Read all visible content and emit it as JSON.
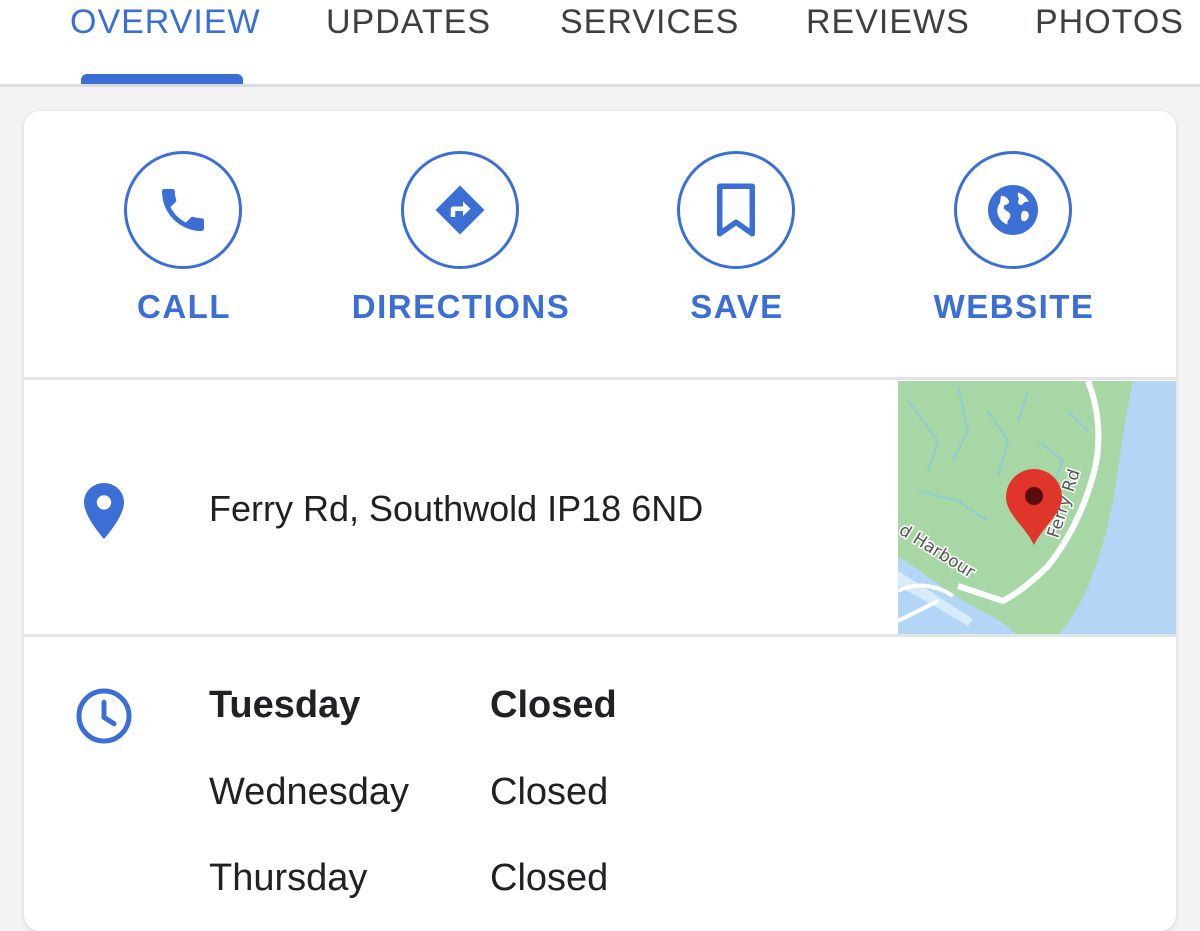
{
  "tabs": [
    {
      "label": "OVERVIEW",
      "active": true
    },
    {
      "label": "UPDATES",
      "active": false
    },
    {
      "label": "SERVICES",
      "active": false
    },
    {
      "label": "REVIEWS",
      "active": false
    },
    {
      "label": "PHOTOS",
      "active": false
    }
  ],
  "actions": [
    {
      "label": "CALL",
      "icon": "phone-icon"
    },
    {
      "label": "DIRECTIONS",
      "icon": "directions-icon"
    },
    {
      "label": "SAVE",
      "icon": "bookmark-icon"
    },
    {
      "label": "WEBSITE",
      "icon": "globe-icon"
    }
  ],
  "address": {
    "text": "Ferry Rd, Southwold IP18 6ND",
    "icon": "location-pin-icon"
  },
  "map": {
    "road_label": "Ferry Rd",
    "harbour_label": "d Harbour",
    "marker": "red-map-marker"
  },
  "hours": {
    "icon": "clock-icon",
    "rows": [
      {
        "day": "Tuesday",
        "status": "Closed",
        "today": true
      },
      {
        "day": "Wednesday",
        "status": "Closed",
        "today": false
      },
      {
        "day": "Thursday",
        "status": "Closed",
        "today": false
      }
    ]
  },
  "colors": {
    "accent": "#3b6fd6",
    "map_land": "#a8d7a6",
    "map_water": "#b3d6f7",
    "map_marker": "#e0352b"
  }
}
